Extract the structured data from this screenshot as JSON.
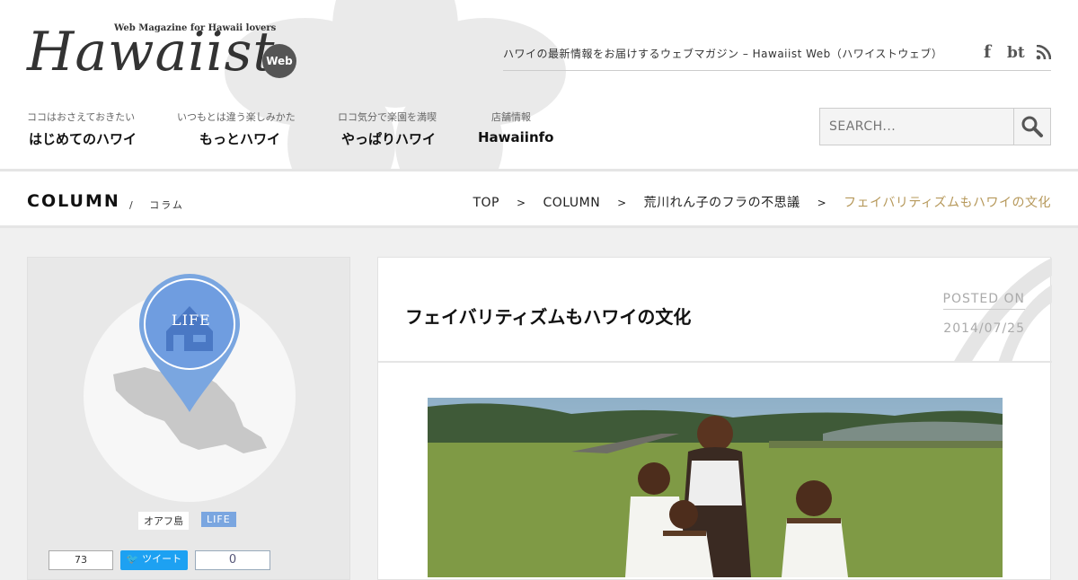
{
  "header": {
    "logo_tagline": "Web Magazine for Hawaii lovers",
    "logo_text": "Hawaiist",
    "logo_badge": "Web",
    "site_tagline": "ハワイの最新情報をお届けするウェブマガジン – Hawaiist Web（ハワイストウェブ）",
    "social": [
      {
        "icon": "facebook-icon",
        "label": "f"
      },
      {
        "icon": "bt-icon",
        "label": "bt"
      },
      {
        "icon": "rss-icon",
        "label": ""
      }
    ],
    "nav": [
      {
        "sub": "ココはおさえておきたい",
        "label": "はじめてのハワイ"
      },
      {
        "sub": "いつもとは違う楽しみかた",
        "label": "もっとハワイ"
      },
      {
        "sub": "ロコ気分で楽園を満喫",
        "label": "やっぱりハワイ"
      },
      {
        "sub": "店舗情報",
        "label": "Hawaiinfo"
      }
    ],
    "search_placeholder": "SEARCH..."
  },
  "section_bar": {
    "title": "COLUMN",
    "divider": "/",
    "subtitle": "コラム",
    "breadcrumb": [
      "TOP",
      "COLUMN",
      "荒川れん子のフラの不思議",
      "フェイバリティズムもハワイの文化"
    ],
    "separator": ">"
  },
  "sidebar": {
    "category_label": "LIFE",
    "tags": [
      "オアフ島",
      "LIFE"
    ],
    "share": {
      "like_count": "73",
      "tweet_label": "ツイート",
      "other_count": "0"
    }
  },
  "article": {
    "title": "フェイバリティズムもハワイの文化",
    "posted_label": "POSTED ON",
    "date": "2014/07/25"
  },
  "colors": {
    "accent_gold": "#b6985a",
    "life_blue": "#7aa6e0",
    "twitter": "#1da1f2"
  }
}
